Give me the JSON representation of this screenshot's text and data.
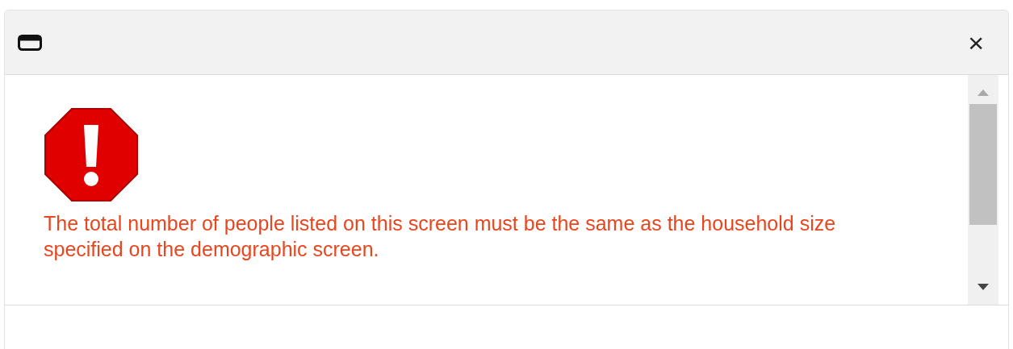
{
  "dialog": {
    "close_label": "×",
    "message": "The total number of people listed on this screen must be the same as the household size specified on the demographic screen."
  }
}
